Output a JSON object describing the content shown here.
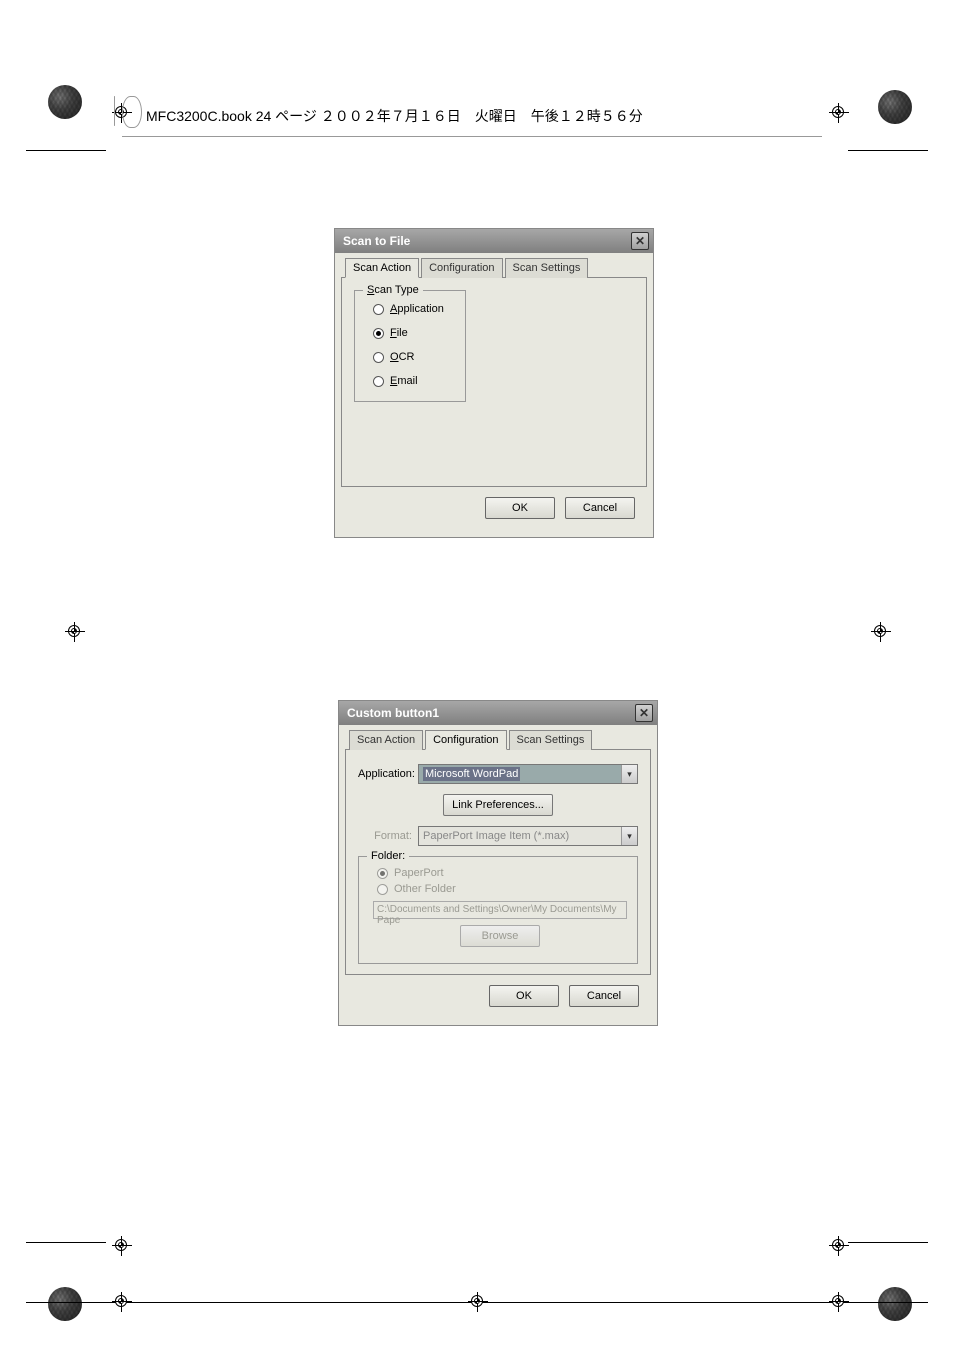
{
  "page_banner": "MFC3200C.book  24 ページ  ２００２年７月１６日　火曜日　午後１２時５６分",
  "dialog1": {
    "title": "Scan to File",
    "tabs": {
      "t1": "Scan Action",
      "t2": "Configuration",
      "t3": "Scan Settings"
    },
    "scan_type_legend": "Scan Type",
    "options": {
      "application": "Application",
      "file": "File",
      "ocr": "OCR",
      "email": "Email"
    },
    "buttons": {
      "ok": "OK",
      "cancel": "Cancel"
    }
  },
  "dialog2": {
    "title": "Custom button1",
    "tabs": {
      "t1": "Scan Action",
      "t2": "Configuration",
      "t3": "Scan Settings"
    },
    "labels": {
      "application": "Application:",
      "format": "Format:",
      "folder": "Folder:"
    },
    "values": {
      "application_selected": "Microsoft WordPad",
      "format_selected": "PaperPort Image Item (*.max)",
      "link_pref": "Link Preferences...",
      "folder_radio": {
        "paperport": "PaperPort",
        "other": "Other Folder"
      },
      "path": "C:\\Documents and Settings\\Owner\\My Documents\\My Pape",
      "browse": "Browse"
    },
    "buttons": {
      "ok": "OK",
      "cancel": "Cancel"
    }
  }
}
